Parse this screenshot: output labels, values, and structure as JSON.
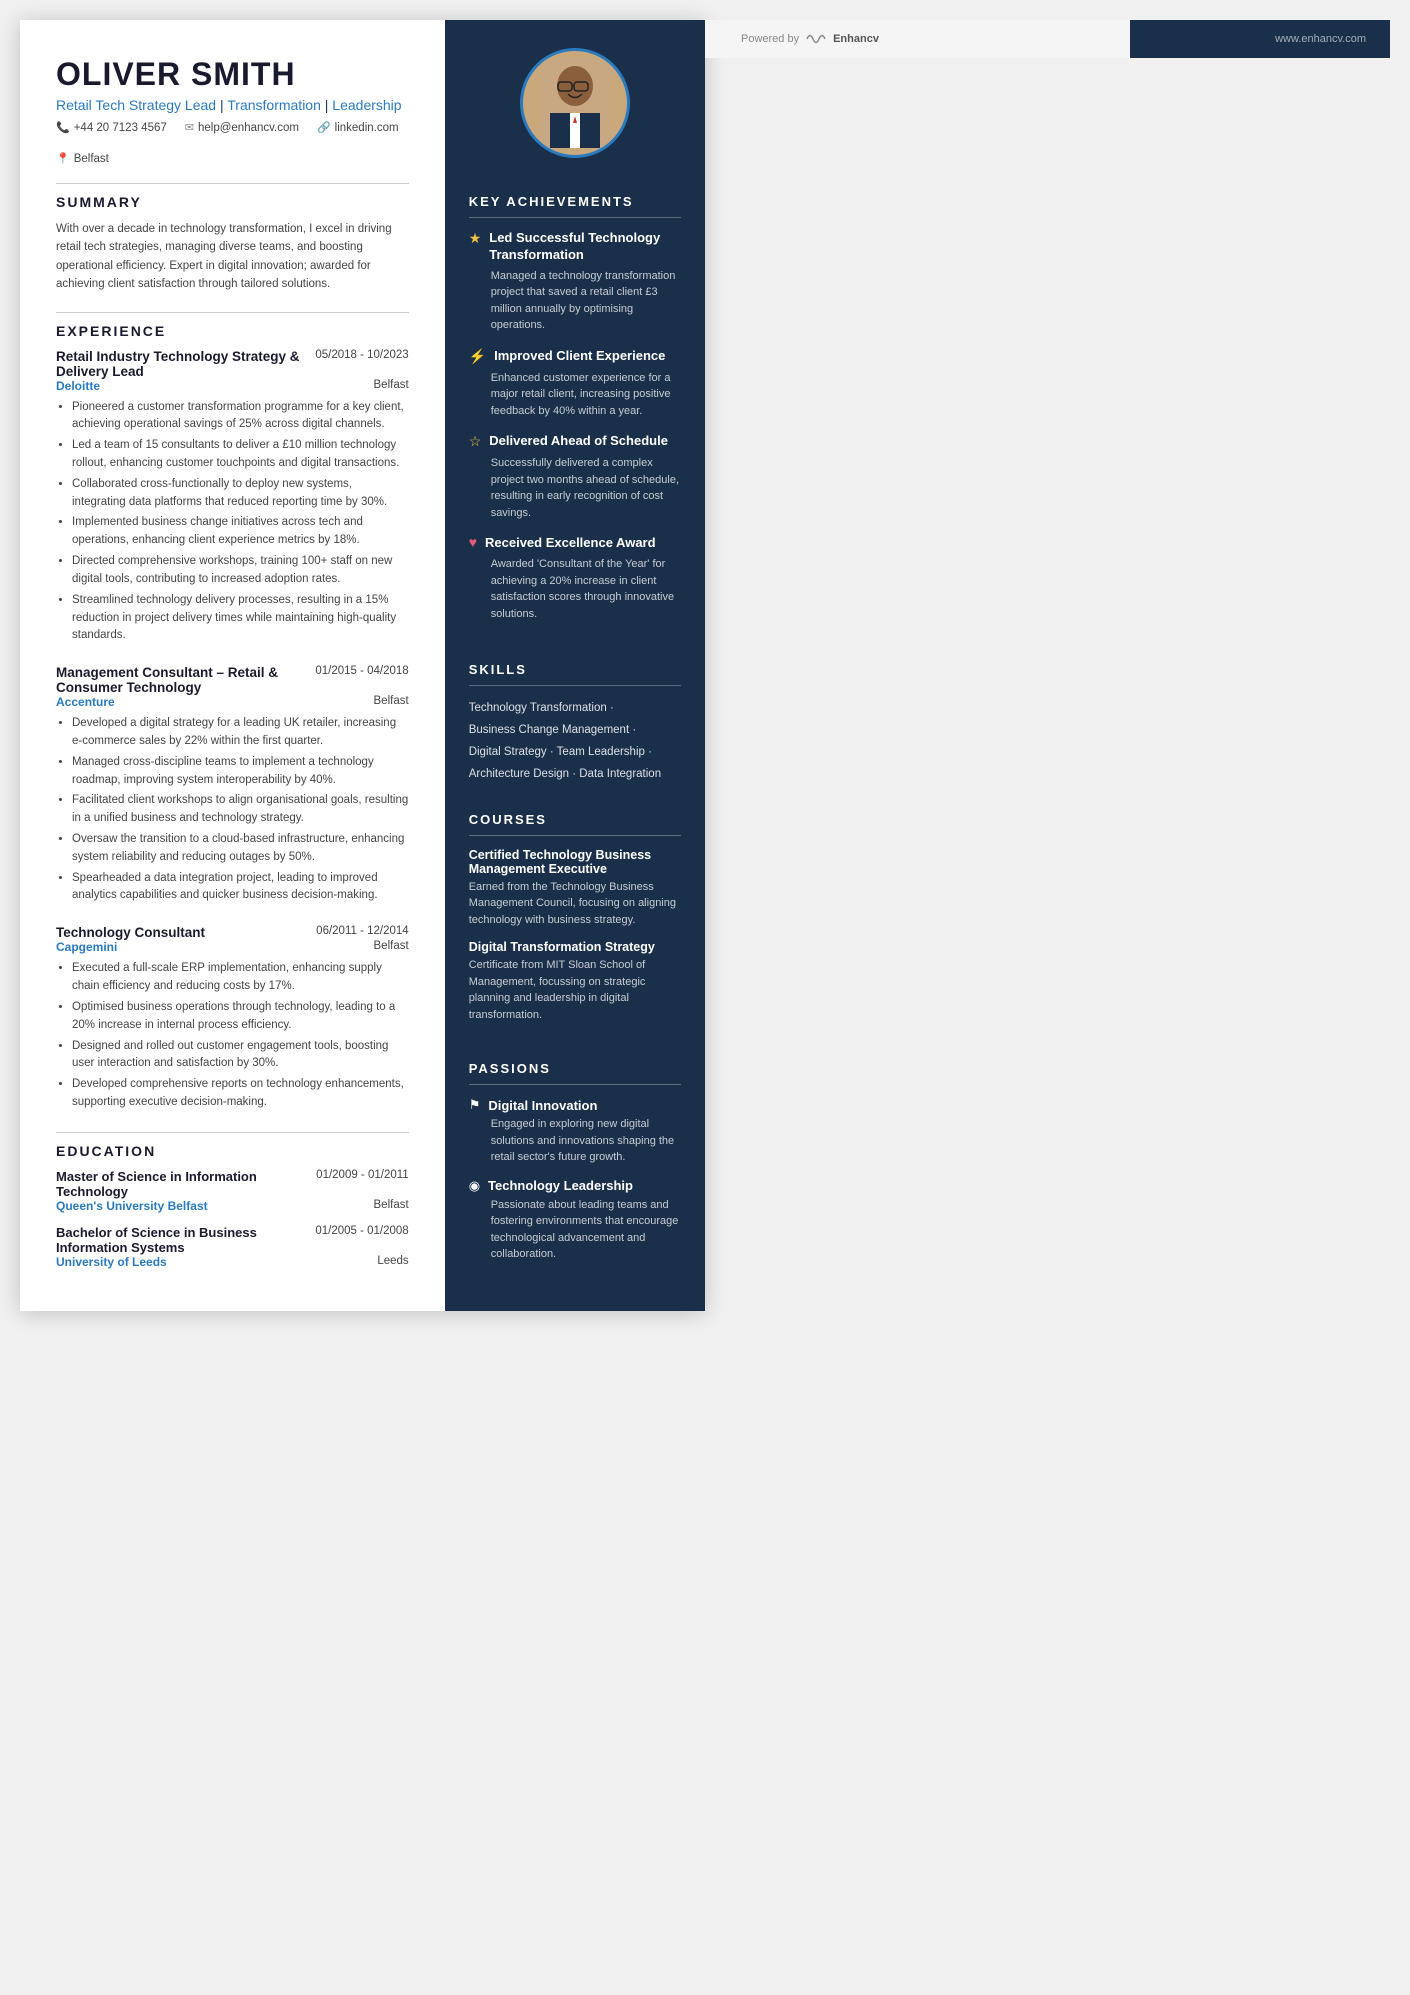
{
  "header": {
    "name": "OLIVER SMITH",
    "title_parts": [
      "Retail Tech Strategy Lead",
      "Transformation",
      "Leadership"
    ],
    "contact": [
      {
        "icon": "📞",
        "text": "+44 20 7123 4567"
      },
      {
        "icon": "✉",
        "text": "help@enhancv.com"
      },
      {
        "icon": "🔗",
        "text": "linkedin.com"
      },
      {
        "icon": "📍",
        "text": "Belfast"
      }
    ]
  },
  "summary": {
    "title": "SUMMARY",
    "text": "With over a decade in technology transformation, I excel in driving retail tech strategies, managing diverse teams, and boosting operational efficiency. Expert in digital innovation; awarded for achieving client satisfaction through tailored solutions."
  },
  "experience": {
    "title": "EXPERIENCE",
    "jobs": [
      {
        "title": "Retail Industry Technology Strategy & Delivery Lead",
        "dates": "05/2018 - 10/2023",
        "company": "Deloitte",
        "location": "Belfast",
        "bullets": [
          "Pioneered a customer transformation programme for a key client, achieving operational savings of 25% across digital channels.",
          "Led a team of 15 consultants to deliver a £10 million technology rollout, enhancing customer touchpoints and digital transactions.",
          "Collaborated cross-functionally to deploy new systems, integrating data platforms that reduced reporting time by 30%.",
          "Implemented business change initiatives across tech and operations, enhancing client experience metrics by 18%.",
          "Directed comprehensive workshops, training 100+ staff on new digital tools, contributing to increased adoption rates.",
          "Streamlined technology delivery processes, resulting in a 15% reduction in project delivery times while maintaining high-quality standards."
        ]
      },
      {
        "title": "Management Consultant – Retail & Consumer Technology",
        "dates": "01/2015 - 04/2018",
        "company": "Accenture",
        "location": "Belfast",
        "bullets": [
          "Developed a digital strategy for a leading UK retailer, increasing e-commerce sales by 22% within the first quarter.",
          "Managed cross-discipline teams to implement a technology roadmap, improving system interoperability by 40%.",
          "Facilitated client workshops to align organisational goals, resulting in a unified business and technology strategy.",
          "Oversaw the transition to a cloud-based infrastructure, enhancing system reliability and reducing outages by 50%.",
          "Spearheaded a data integration project, leading to improved analytics capabilities and quicker business decision-making."
        ]
      },
      {
        "title": "Technology Consultant",
        "dates": "06/2011 - 12/2014",
        "company": "Capgemini",
        "location": "Belfast",
        "bullets": [
          "Executed a full-scale ERP implementation, enhancing supply chain efficiency and reducing costs by 17%.",
          "Optimised business operations through technology, leading to a 20% increase in internal process efficiency.",
          "Designed and rolled out customer engagement tools, boosting user interaction and satisfaction by 30%.",
          "Developed comprehensive reports on technology enhancements, supporting executive decision-making."
        ]
      }
    ]
  },
  "education": {
    "title": "EDUCATION",
    "items": [
      {
        "degree": "Master of Science in Information Technology",
        "dates": "01/2009 - 01/2011",
        "school": "Queen's University Belfast",
        "location": "Belfast"
      },
      {
        "degree": "Bachelor of Science in Business Information Systems",
        "dates": "01/2005 - 01/2008",
        "school": "University of Leeds",
        "location": "Leeds"
      }
    ]
  },
  "achievements": {
    "title": "KEY ACHIEVEMENTS",
    "items": [
      {
        "icon": "★",
        "title": "Led Successful Technology Transformation",
        "desc": "Managed a technology transformation project that saved a retail client £3 million annually by optimising operations."
      },
      {
        "icon": "⚡",
        "title": "Improved Client Experience",
        "desc": "Enhanced customer experience for a major retail client, increasing positive feedback by 40% within a year."
      },
      {
        "icon": "☆",
        "title": "Delivered Ahead of Schedule",
        "desc": "Successfully delivered a complex project two months ahead of schedule, resulting in early recognition of cost savings."
      },
      {
        "icon": "♥",
        "title": "Received Excellence Award",
        "desc": "Awarded 'Consultant of the Year' for achieving a 20% increase in client satisfaction scores through innovative solutions."
      }
    ]
  },
  "skills": {
    "title": "SKILLS",
    "lines": [
      "Technology Transformation ·",
      "Business Change Management ·",
      "Digital Strategy · Team Leadership ·",
      "Architecture Design · Data Integration"
    ]
  },
  "courses": {
    "title": "COURSES",
    "items": [
      {
        "title": "Certified Technology Business Management Executive",
        "desc": "Earned from the Technology Business Management Council, focusing on aligning technology with business strategy."
      },
      {
        "title": "Digital Transformation Strategy",
        "desc": "Certificate from MIT Sloan School of Management, focussing on strategic planning and leadership in digital transformation."
      }
    ]
  },
  "passions": {
    "title": "PASSIONS",
    "items": [
      {
        "icon": "⚑",
        "title": "Digital Innovation",
        "desc": "Engaged in exploring new digital solutions and innovations shaping the retail sector's future growth."
      },
      {
        "icon": "◉",
        "title": "Technology Leadership",
        "desc": "Passionate about leading teams and fostering environments that encourage technological advancement and collaboration."
      }
    ]
  },
  "footer": {
    "powered_by": "Powered by",
    "brand": "Enhancv",
    "website": "www.enhancv.com"
  }
}
